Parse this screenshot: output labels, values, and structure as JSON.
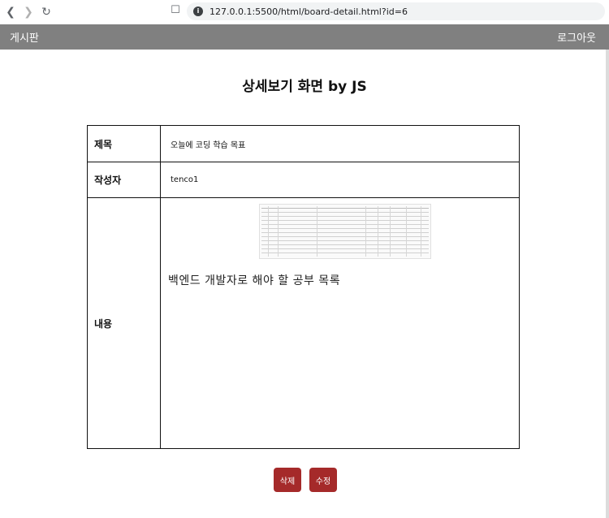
{
  "browser": {
    "url": "127.0.0.1:5500/html/board-detail.html?id=6"
  },
  "header": {
    "brand": "게시판",
    "logout": "로그아웃"
  },
  "page": {
    "title": "상세보기 화면 by JS"
  },
  "detail": {
    "title_label": "제목",
    "title_value": "오늘에 코딩 학습 목표",
    "author_label": "작성자",
    "author_value": "tenco1",
    "content_label": "내용",
    "content_text": "백엔드 개발자로 해야 할 공부 목록"
  },
  "actions": {
    "delete": "삭제",
    "edit": "수정"
  }
}
